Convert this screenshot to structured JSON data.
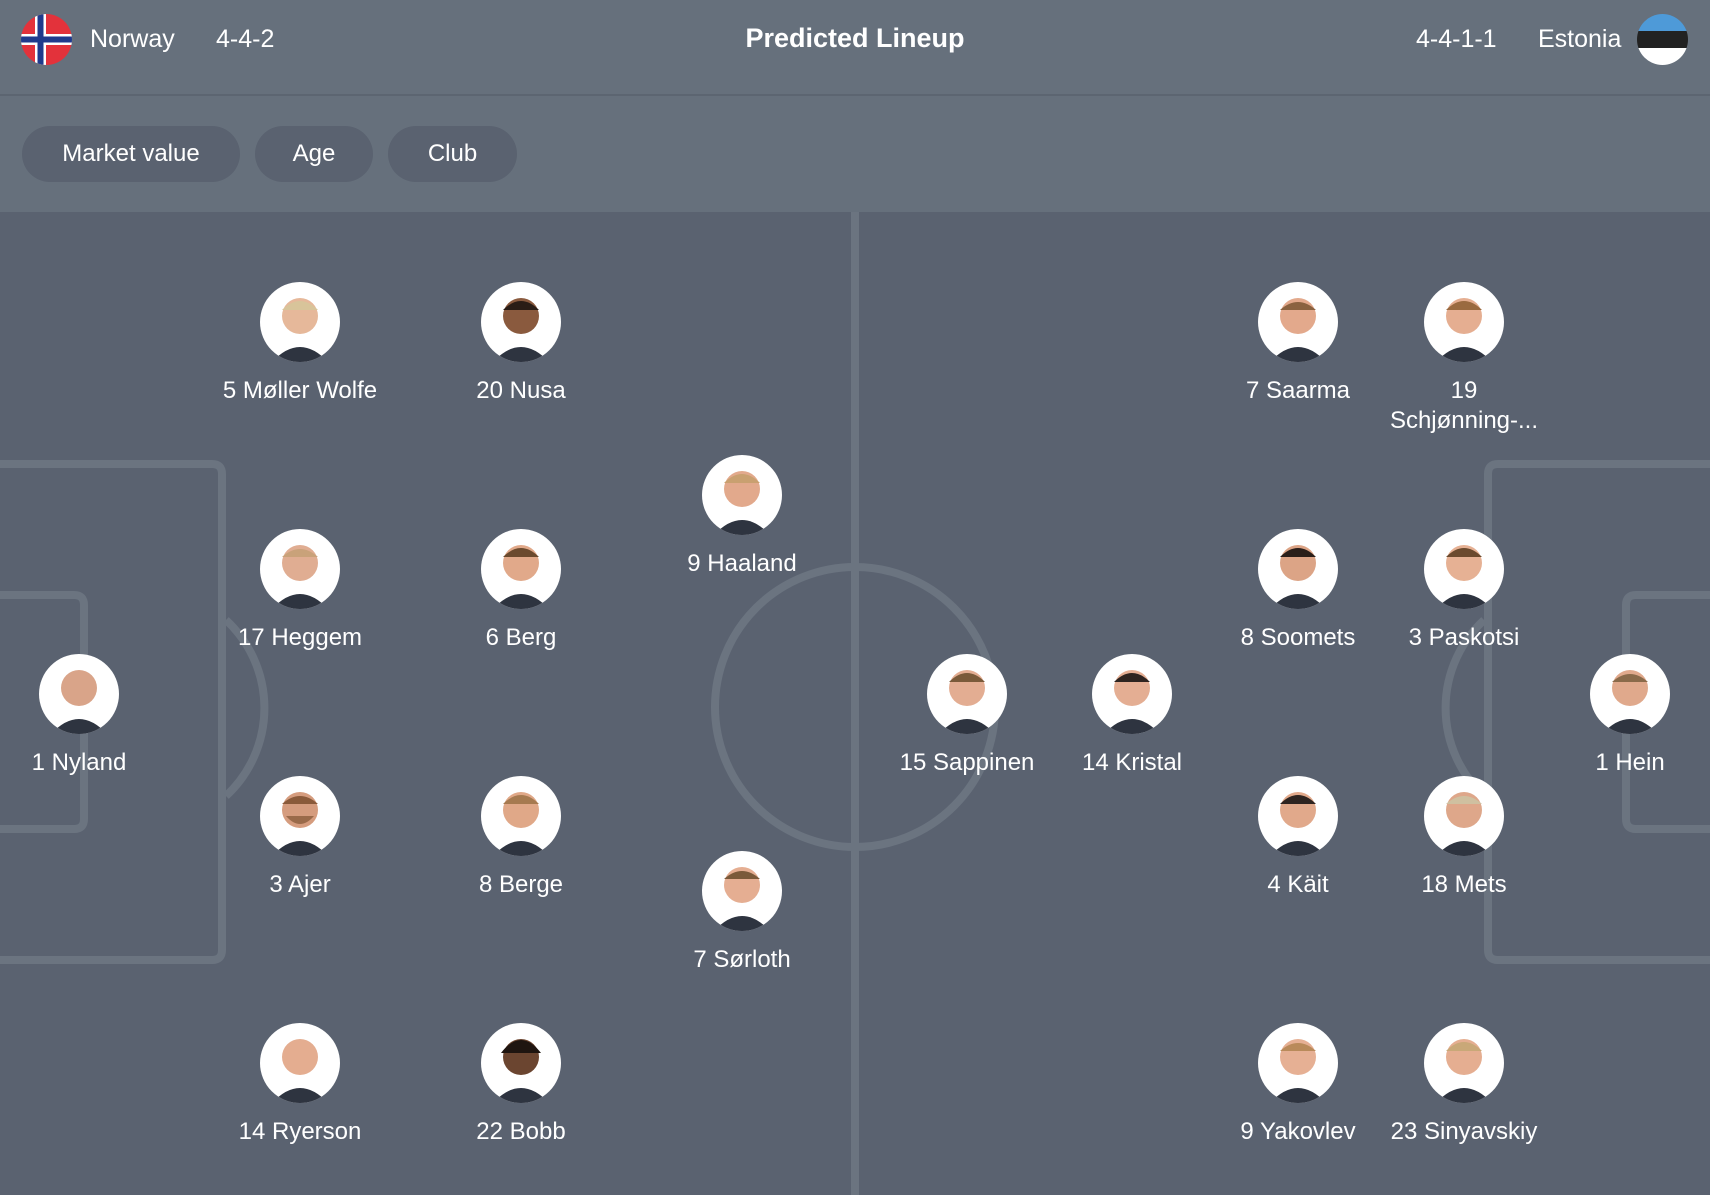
{
  "header": {
    "title": "Predicted Lineup",
    "home": {
      "name": "Norway",
      "formation": "4-4-2",
      "flag_icon": "norway-flag-icon"
    },
    "away": {
      "name": "Estonia",
      "formation": "4-4-1-1",
      "flag_icon": "estonia-flag-icon"
    }
  },
  "filters": {
    "market_value": "Market value",
    "age": "Age",
    "club": "Club"
  },
  "colors": {
    "pitch": "#5a6270",
    "bar": "#66707c",
    "line": "#6b7480",
    "norway_red": "#e3323b",
    "norway_blue": "#1f3a8c",
    "estonia_blue": "#4e9ad8"
  },
  "norway_players": {
    "nyland": "1 Nyland",
    "moller_wolfe": "5 Møller Wolfe",
    "heggem": "17 Heggem",
    "ajer": "3 Ajer",
    "ryerson": "14 Ryerson",
    "nusa": "20 Nusa",
    "berg": "6 Berg",
    "berge": "8 Berge",
    "bobb": "22 Bobb",
    "haaland": "9 Haaland",
    "sorloth": "7 Sørloth"
  },
  "estonia_players": {
    "sappinen": "15 Sappinen",
    "kristal": "14 Kristal",
    "saarma": "7 Saarma",
    "soomets": "8 Soomets",
    "kait": "4 Käit",
    "yakovlev": "9 Yakovlev",
    "schjonning": "19 Schjønning-...",
    "paskotsi": "3 Paskotsi",
    "mets": "18 Mets",
    "sinyavskiy": "23 Sinyavskiy",
    "hein": "1 Hein"
  }
}
